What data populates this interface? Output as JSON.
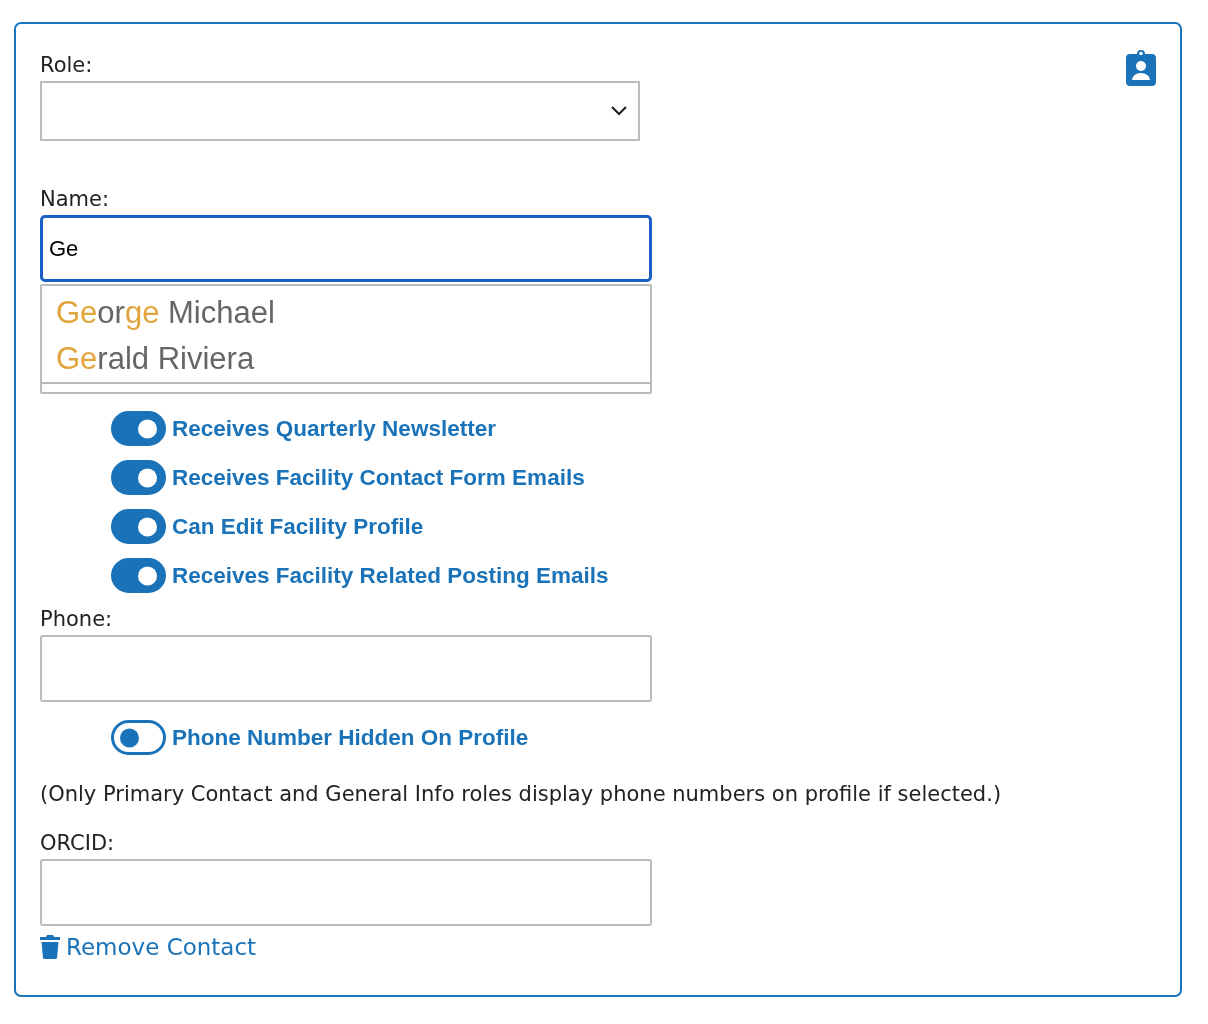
{
  "role": {
    "label": "Role:"
  },
  "name": {
    "label": "Name:",
    "value": "Ge",
    "focused": true,
    "suggestions": [
      {
        "parts": [
          {
            "text": "Ge",
            "match": true
          },
          {
            "text": "or",
            "match": false
          },
          {
            "text": "ge",
            "match": true
          },
          {
            "text": " Michael",
            "match": false
          }
        ]
      },
      {
        "parts": [
          {
            "text": "Ge",
            "match": true
          },
          {
            "text": "rald Riviera",
            "match": false
          }
        ]
      }
    ]
  },
  "toggles": [
    {
      "label": "Receives Quarterly Newsletter",
      "on": true
    },
    {
      "label": "Receives Facility Contact Form Emails",
      "on": true
    },
    {
      "label": "Can Edit Facility Profile",
      "on": true
    },
    {
      "label": "Receives Facility Related Posting Emails",
      "on": true
    }
  ],
  "phone": {
    "label": "Phone:"
  },
  "phone_toggle": {
    "label": "Phone Number Hidden On Profile",
    "on": false
  },
  "phone_note": "(Only Primary Contact and General Info roles display phone numbers on profile if selected.)",
  "orcid": {
    "label": "ORCID:"
  },
  "remove_link": "Remove Contact"
}
